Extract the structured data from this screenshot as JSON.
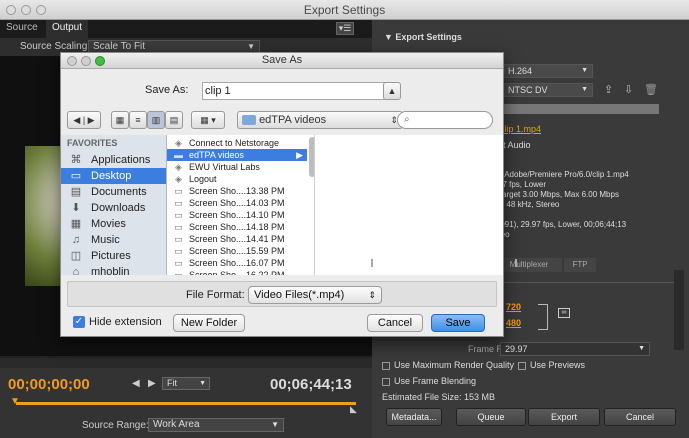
{
  "window": {
    "title": "Export Settings"
  },
  "left_panel": {
    "tabs": [
      "Source",
      "Output"
    ],
    "source_scaling_label": "Source Scaling:",
    "source_scaling_value": "Scale To Fit",
    "timecode_start": "00;00;00;00",
    "fit_value": "Fit",
    "timecode_end": "00;06;44;13",
    "source_range_label": "Source Range:",
    "source_range_value": "Work Area"
  },
  "right_panel": {
    "section_title": "Export Settings",
    "format_value": "H.264",
    "preset_value": "NTSC DV",
    "output_name": "clip 1.mp4",
    "audio_fragment": "rt Audio",
    "summary_lines": [
      "s/Adobe/Premiere Pro/6.0/clip 1.mp4",
      "97 fps, Lower",
      "Target 3.00 Mbps, Max 6.00 Mbps",
      "z, 48 kHz, Stereo",
      "1",
      ".091), 29.97 fps, Lower, 00;06;44;13",
      "reo"
    ],
    "tabs": [
      "Multiplexer",
      "FTP"
    ],
    "width_value": "720",
    "height_value": "480",
    "frame_rate_label": "Frame Rate:",
    "frame_rate_value": "29.97",
    "use_max_render": "Use Maximum Render Quality",
    "use_previews": "Use Previews",
    "use_frame_blending": "Use Frame Blending",
    "estimated_size": "Estimated File Size: 153 MB",
    "buttons": {
      "metadata": "Metadata...",
      "queue": "Queue",
      "export": "Export",
      "cancel": "Cancel"
    }
  },
  "dialog": {
    "title": "Save As",
    "save_as_label": "Save As:",
    "save_as_value": "clip 1",
    "location": "edTPA videos",
    "search_placeholder": "",
    "favorites_header": "FAVORITES",
    "favorites": [
      {
        "label": "Applications",
        "icon": "applications-icon"
      },
      {
        "label": "Desktop",
        "icon": "desktop-icon",
        "selected": true
      },
      {
        "label": "Documents",
        "icon": "documents-icon"
      },
      {
        "label": "Downloads",
        "icon": "downloads-icon"
      },
      {
        "label": "Movies",
        "icon": "movies-icon"
      },
      {
        "label": "Music",
        "icon": "music-icon"
      },
      {
        "label": "Pictures",
        "icon": "pictures-icon"
      },
      {
        "label": "mhoblin",
        "icon": "home-icon"
      }
    ],
    "files": [
      {
        "label": "Connect to Netstorage",
        "icon": "app-icon"
      },
      {
        "label": "edTPA videos",
        "icon": "folder-icon",
        "selected": true
      },
      {
        "label": "EWU Virtual Labs",
        "icon": "app-icon"
      },
      {
        "label": "Logout",
        "icon": "app-icon"
      },
      {
        "label": "Screen Sho....13.38 PM",
        "icon": "image-icon"
      },
      {
        "label": "Screen Sho....14.03 PM",
        "icon": "image-icon"
      },
      {
        "label": "Screen Sho....14.10 PM",
        "icon": "image-icon"
      },
      {
        "label": "Screen Sho....14.18 PM",
        "icon": "image-icon"
      },
      {
        "label": "Screen Sho....14.41 PM",
        "icon": "image-icon"
      },
      {
        "label": "Screen Sho....15.59 PM",
        "icon": "image-icon"
      },
      {
        "label": "Screen Sho....16.07 PM",
        "icon": "image-icon"
      },
      {
        "label": "Screen Sho....16.22 PM",
        "icon": "image-icon"
      }
    ],
    "file_format_label": "File Format:",
    "file_format_value": "Video Files(*.mp4)",
    "hide_extension_label": "Hide extension",
    "new_folder_label": "New Folder",
    "cancel_label": "Cancel",
    "save_label": "Save"
  },
  "colors": {
    "accent_orange": "#f29b1d",
    "save_blue": "#3d8fe8",
    "selection_blue": "#3b7ee0"
  }
}
